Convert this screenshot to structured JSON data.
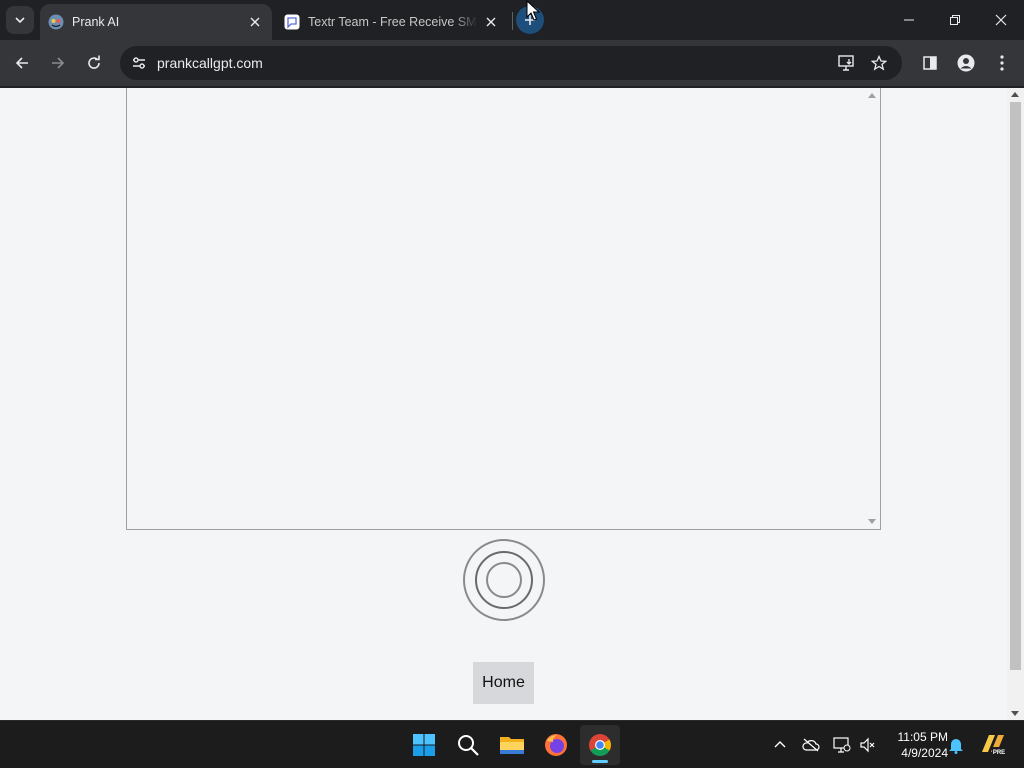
{
  "browser": {
    "tabs": [
      {
        "title": "Prank AI",
        "active": true
      },
      {
        "title": "Textr Team - Free Receive SMS Online",
        "active": false
      }
    ],
    "url": "prankcallgpt.com"
  },
  "page": {
    "home_label": "Home"
  },
  "taskbar": {
    "time": "11:05 PM",
    "date": "4/9/2024",
    "badge": "PRE"
  },
  "colors": {
    "page_background": "#f3f5f7",
    "home_button": "#d6d8dc",
    "chrome_dark": "#202124",
    "chrome_toolbar": "#35363a"
  }
}
